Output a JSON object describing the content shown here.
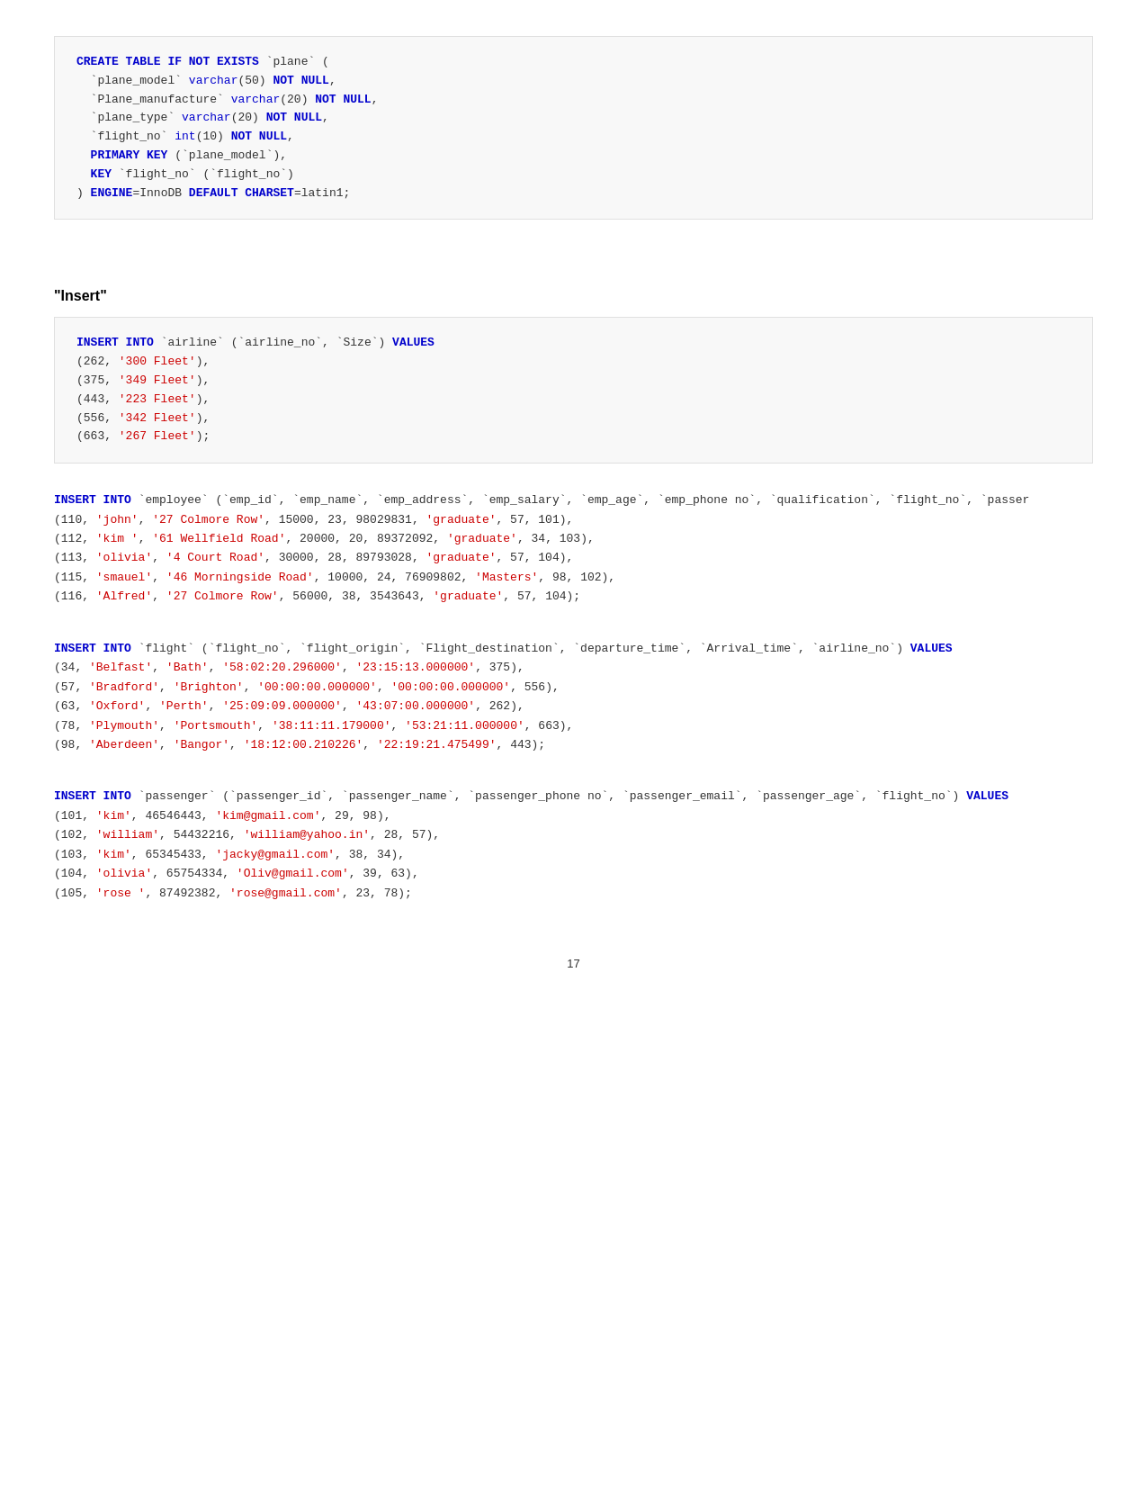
{
  "page": {
    "number": "17"
  },
  "sections": {
    "create_heading": "",
    "insert_heading": "\"Insert\"",
    "create_code": "CREATE TABLE IF NOT EXISTS `plane` (\n  `plane_model` varchar(50) NOT NULL,\n  `Plane_manufacture` varchar(20) NOT NULL,\n  `plane_type` varchar(20) NOT NULL,\n  `flight_no` int(10) NOT NULL,\n  PRIMARY KEY (`plane_model`),\n  KEY `flight_no` (`flight_no`)\n) ENGINE=InnoDB DEFAULT CHARSET=latin1;"
  }
}
